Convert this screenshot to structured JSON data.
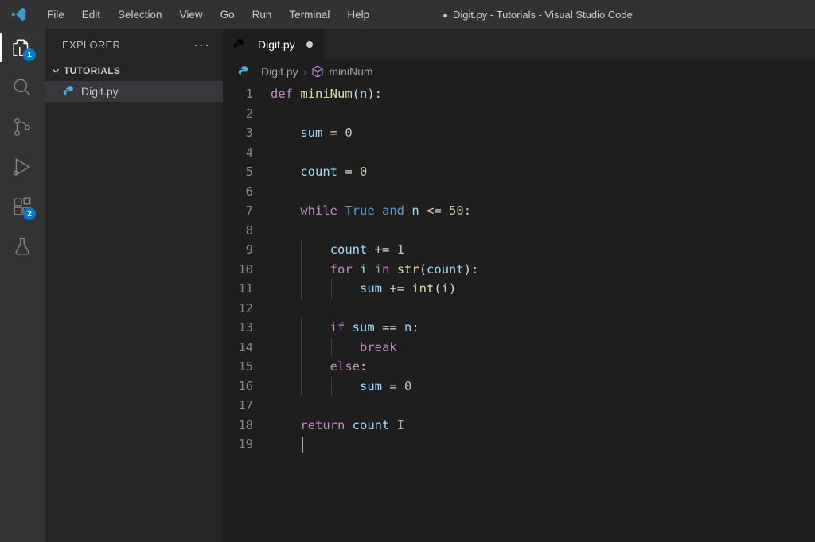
{
  "titlebar": {
    "menus": [
      "File",
      "Edit",
      "Selection",
      "View",
      "Go",
      "Run",
      "Terminal",
      "Help"
    ],
    "title": "Digit.py - Tutorials - Visual Studio Code",
    "dirty": true
  },
  "activitybar": {
    "explorerBadge": "1",
    "extensionsBadge": "2"
  },
  "sidebar": {
    "title": "EXPLORER",
    "section": "TUTORIALS",
    "files": [
      "Digit.py"
    ]
  },
  "tabs": [
    {
      "label": "Digit.py",
      "dirty": true
    }
  ],
  "breadcrumbs": {
    "file": "Digit.py",
    "symbol": "miniNum"
  },
  "code": {
    "lineCount": 19,
    "lines": [
      {
        "n": 1,
        "tokens": [
          [
            "kw",
            "def "
          ],
          [
            "fn",
            "miniNum"
          ],
          [
            "op",
            "("
          ],
          [
            "var",
            "n"
          ],
          [
            "op",
            "):"
          ]
        ]
      },
      {
        "n": 2,
        "tokens": []
      },
      {
        "n": 3,
        "indent": 1,
        "tokens": [
          [
            "var",
            "sum"
          ],
          [
            "op",
            " = "
          ],
          [
            "num",
            "0"
          ]
        ]
      },
      {
        "n": 4,
        "tokens": []
      },
      {
        "n": 5,
        "indent": 1,
        "tokens": [
          [
            "var",
            "count"
          ],
          [
            "op",
            " = "
          ],
          [
            "num",
            "0"
          ]
        ]
      },
      {
        "n": 6,
        "tokens": []
      },
      {
        "n": 7,
        "indent": 1,
        "tokens": [
          [
            "kw",
            "while"
          ],
          [
            "op",
            " "
          ],
          [
            "bool",
            "True"
          ],
          [
            "op",
            " "
          ],
          [
            "kw2",
            "and"
          ],
          [
            "op",
            " "
          ],
          [
            "var",
            "n"
          ],
          [
            "op",
            " <= "
          ],
          [
            "num",
            "50"
          ],
          [
            "op",
            ":"
          ]
        ]
      },
      {
        "n": 8,
        "tokens": []
      },
      {
        "n": 9,
        "indent": 2,
        "tokens": [
          [
            "var",
            "count"
          ],
          [
            "op",
            " += "
          ],
          [
            "num",
            "1"
          ]
        ]
      },
      {
        "n": 10,
        "indent": 2,
        "tokens": [
          [
            "kw",
            "for"
          ],
          [
            "op",
            " "
          ],
          [
            "var",
            "i"
          ],
          [
            "op",
            " "
          ],
          [
            "kw",
            "in"
          ],
          [
            "op",
            " "
          ],
          [
            "fn",
            "str"
          ],
          [
            "op",
            "("
          ],
          [
            "var",
            "count"
          ],
          [
            "op",
            "):"
          ]
        ]
      },
      {
        "n": 11,
        "indent": 3,
        "tokens": [
          [
            "var",
            "sum"
          ],
          [
            "op",
            " += "
          ],
          [
            "fn",
            "int"
          ],
          [
            "op",
            "("
          ],
          [
            "var",
            "i"
          ],
          [
            "op",
            ")"
          ]
        ]
      },
      {
        "n": 12,
        "tokens": []
      },
      {
        "n": 13,
        "indent": 2,
        "tokens": [
          [
            "kw",
            "if"
          ],
          [
            "op",
            " "
          ],
          [
            "var",
            "sum"
          ],
          [
            "op",
            " == "
          ],
          [
            "var",
            "n"
          ],
          [
            "op",
            ":"
          ]
        ]
      },
      {
        "n": 14,
        "indent": 3,
        "tokens": [
          [
            "kw",
            "break"
          ]
        ]
      },
      {
        "n": 15,
        "indent": 2,
        "tokens": [
          [
            "kw",
            "else"
          ],
          [
            "op",
            ":"
          ]
        ]
      },
      {
        "n": 16,
        "indent": 3,
        "tokens": [
          [
            "var",
            "sum"
          ],
          [
            "op",
            " = "
          ],
          [
            "num",
            "0"
          ]
        ]
      },
      {
        "n": 17,
        "tokens": []
      },
      {
        "n": 18,
        "indent": 1,
        "tokens": [
          [
            "kw",
            "return"
          ],
          [
            "op",
            " "
          ],
          [
            "var",
            "count"
          ]
        ],
        "ibeam": true
      },
      {
        "n": 19,
        "indent": 1,
        "tokens": [],
        "caret": true
      }
    ]
  }
}
